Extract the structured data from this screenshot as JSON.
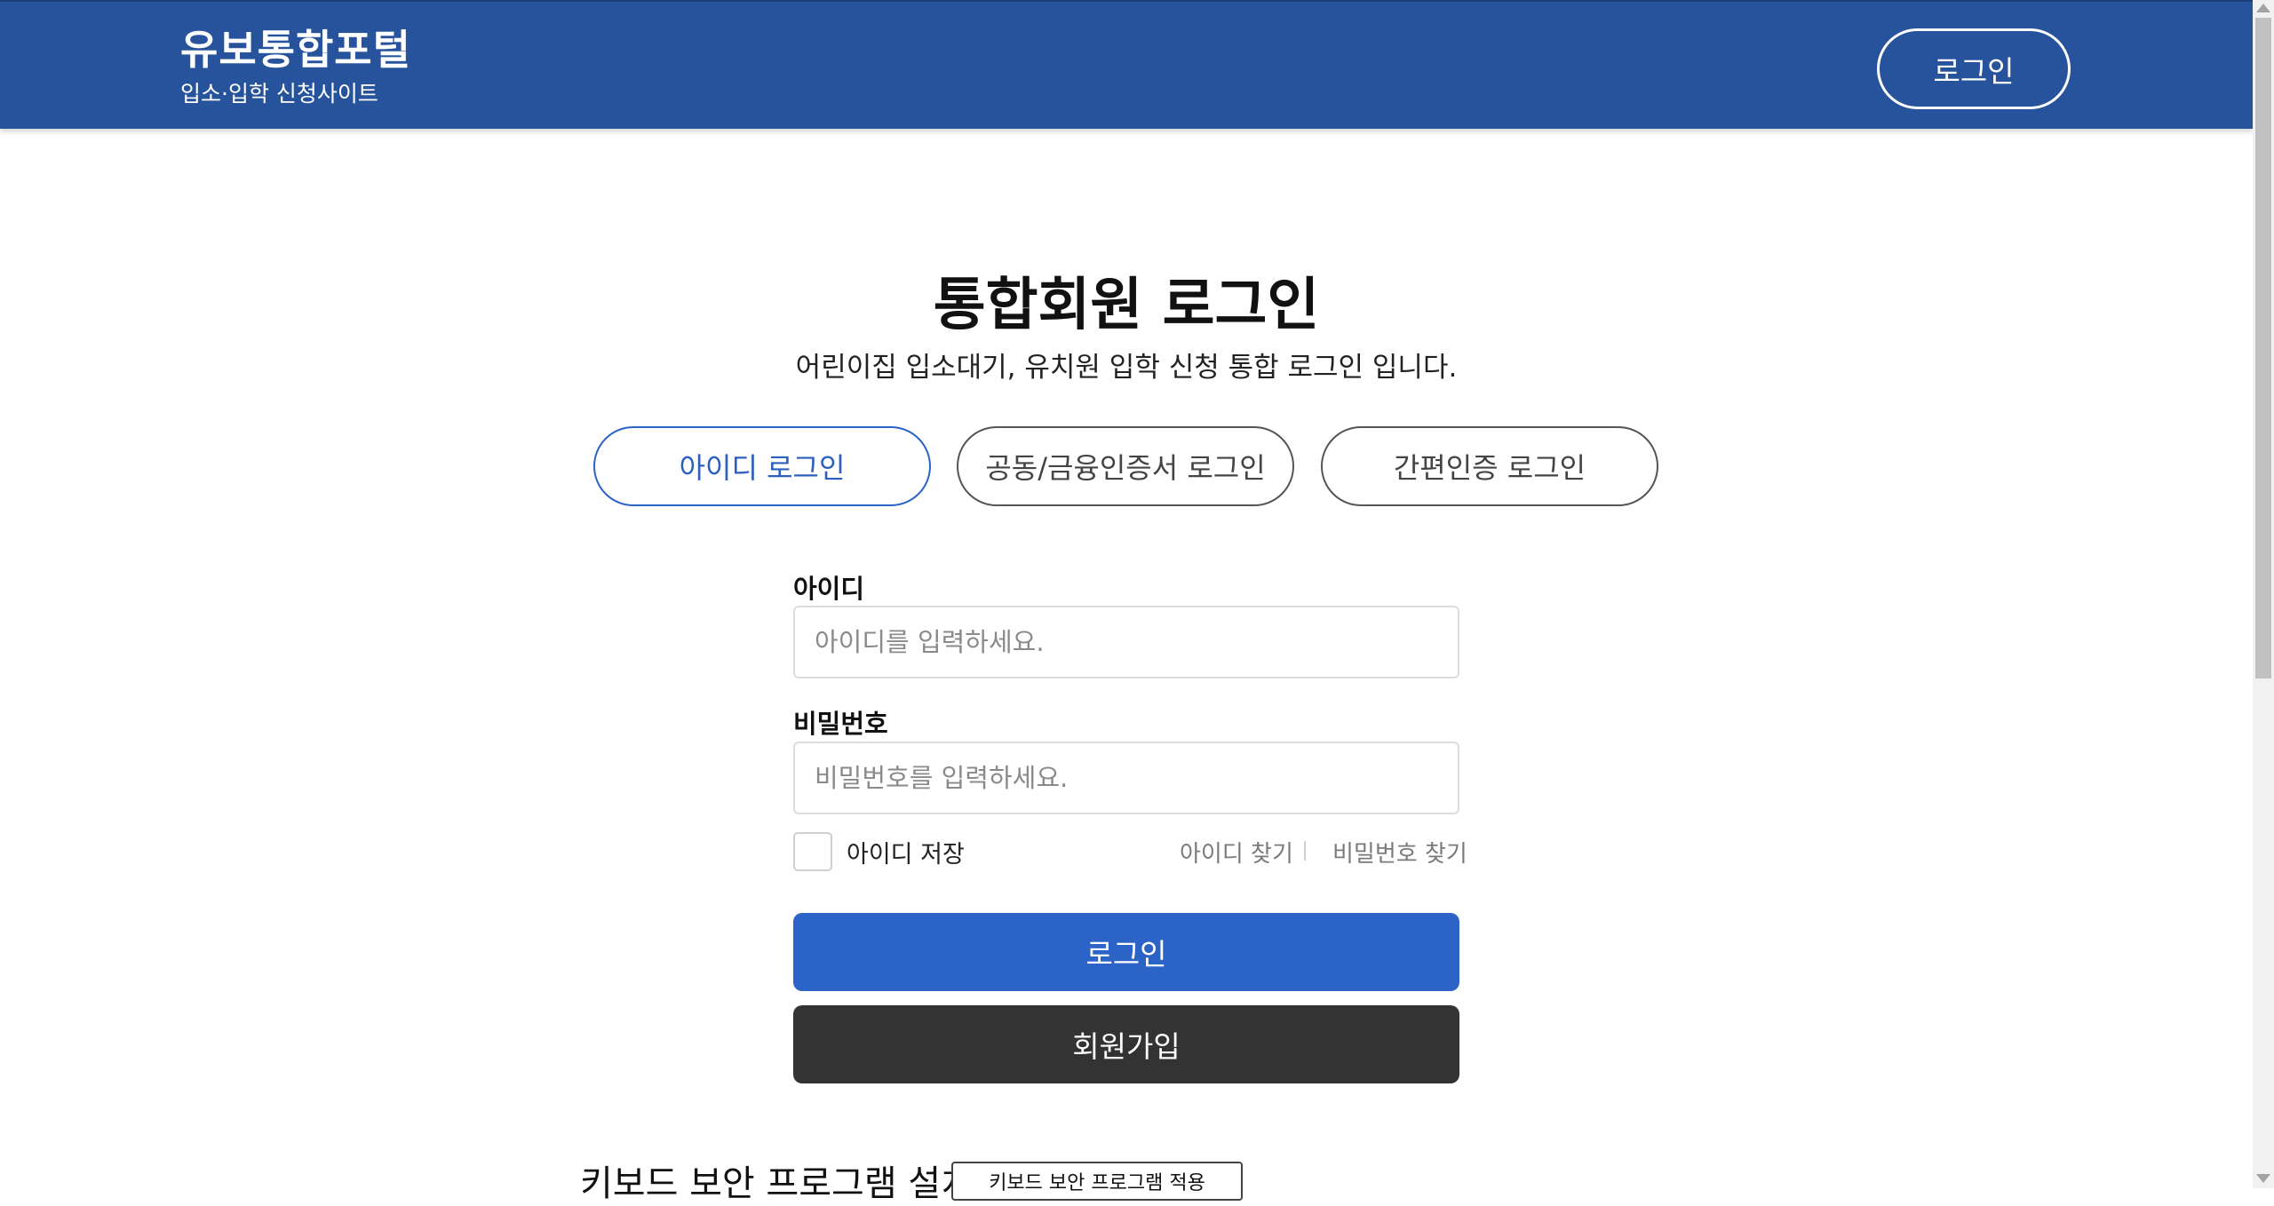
{
  "header": {
    "title": "유보통합포털",
    "subtitle": "입소·입학 신청사이트",
    "login_button": "로그인"
  },
  "main": {
    "title": "통합회원 로그인",
    "description": "어린이집 입소대기, 유치원 입학 신청 통합 로그인 입니다.",
    "tabs": [
      {
        "label": "아이디 로그인",
        "active": true
      },
      {
        "label": "공동/금융인증서 로그인",
        "active": false
      },
      {
        "label": "간편인증 로그인",
        "active": false
      }
    ],
    "id_label": "아이디",
    "id_placeholder": "아이디를 입력하세요.",
    "password_label": "비밀번호",
    "password_placeholder": "비밀번호를 입력하세요.",
    "save_id_label": "아이디 저장",
    "find_id_link": "아이디 찾기",
    "find_password_link": "비밀번호 찾기",
    "login_button": "로그인",
    "signup_button": "회원가입",
    "keyboard_security_title": "키보드 보안 프로그램 설치",
    "keyboard_security_button": "키보드 보안 프로그램 적용"
  },
  "colors": {
    "header_bg": "#26539c",
    "accent": "#2c63c6",
    "signup_bg": "#333333"
  }
}
